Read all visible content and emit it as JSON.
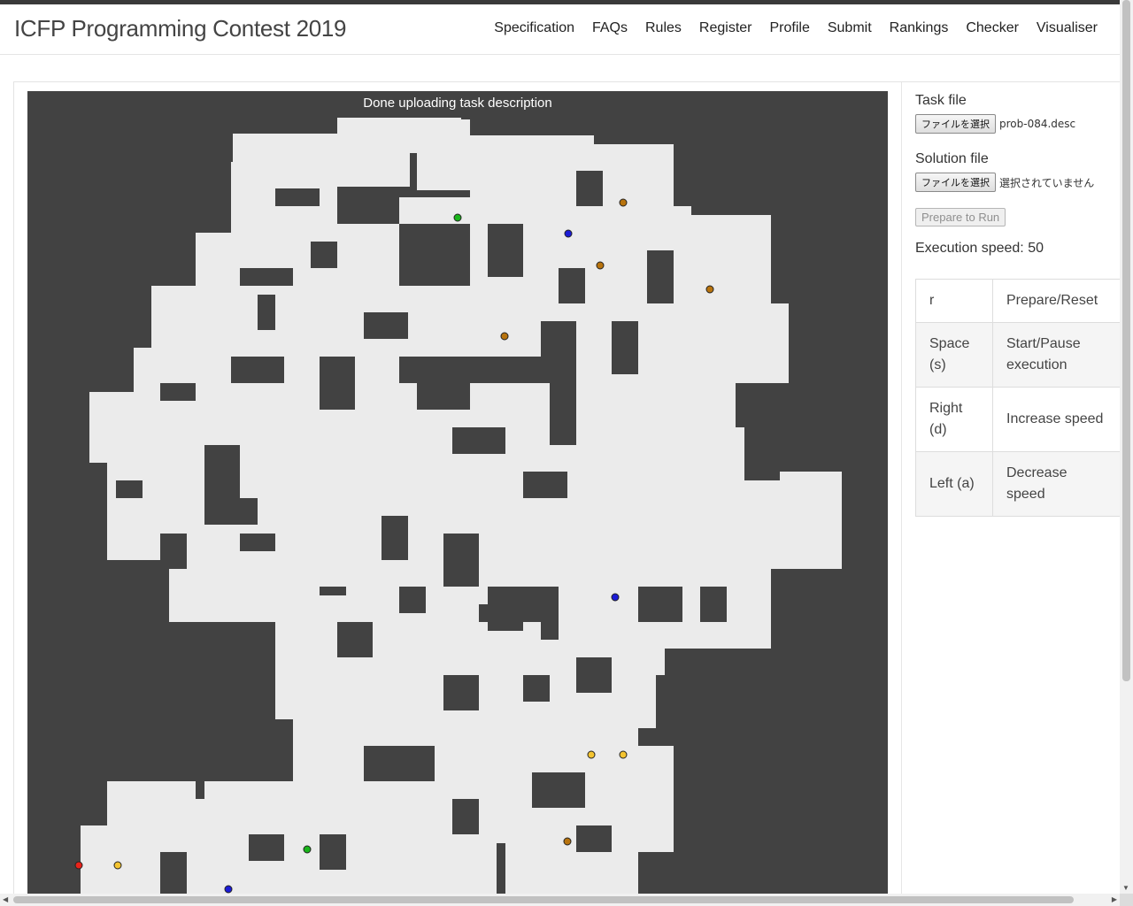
{
  "brand": "ICFP Programming Contest 2019",
  "nav": [
    "Specification",
    "FAQs",
    "Rules",
    "Register",
    "Profile",
    "Submit",
    "Rankings",
    "Checker",
    "Visualiser"
  ],
  "visualiser": {
    "status": "Done uploading task description",
    "colors": {
      "background": "#424242",
      "floor": "#ebebeb",
      "worker": "#e8231a",
      "booster_yellow": "#f4c430",
      "booster_brown": "#b8730d",
      "booster_green": "#19b51a",
      "booster_blue": "#1b1bd6"
    }
  },
  "task_file": {
    "label": "Task file",
    "button": "ファイルを選択",
    "filename": "prob-084.desc"
  },
  "solution_file": {
    "label": "Solution file",
    "button": "ファイルを選択",
    "filename": "選択されていません"
  },
  "run_button": "Prepare to Run",
  "speed_text": "Execution speed: 50",
  "shortcuts": [
    {
      "key": "r",
      "action": "Prepare/Reset"
    },
    {
      "key": "Space (s)",
      "action": "Start/Pause execution"
    },
    {
      "key": "Right (d)",
      "action": "Increase speed"
    },
    {
      "key": "Left (a)",
      "action": "Decrease speed"
    }
  ]
}
